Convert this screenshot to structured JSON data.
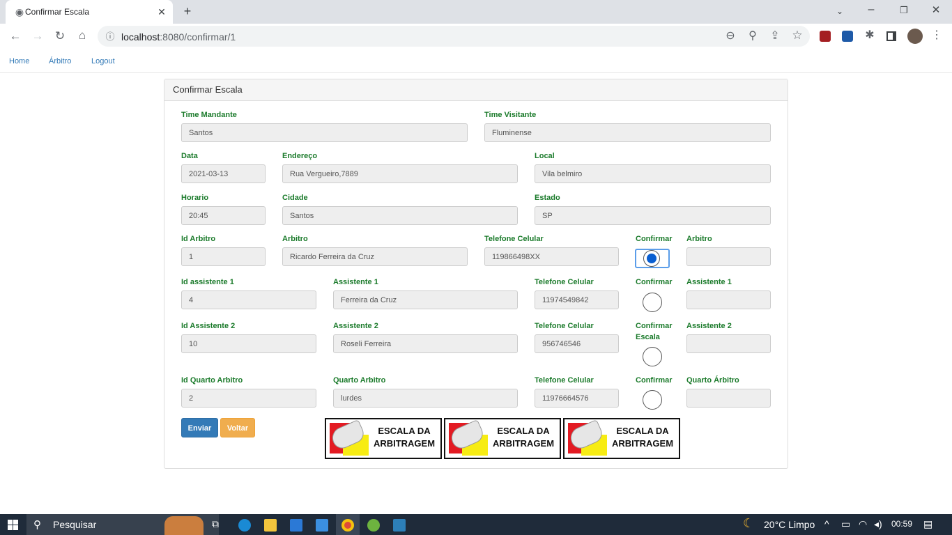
{
  "browser": {
    "tab_title": "Confirmar Escala",
    "url_host": "localhost",
    "url_rest": ":8080/confirmar/1"
  },
  "nav": {
    "home": "Home",
    "arbitro": "Árbitro",
    "logout": "Logout"
  },
  "panel": {
    "title": "Confirmar Escala"
  },
  "form": {
    "time_mandante": {
      "label": "Time Mandante",
      "value": "Santos"
    },
    "time_visitante": {
      "label": "Time Visitante",
      "value": "Fluminense"
    },
    "data": {
      "label": "Data",
      "value": "2021-03-13"
    },
    "endereco": {
      "label": "Endereço",
      "value": "Rua Vergueiro,7889"
    },
    "local": {
      "label": "Local",
      "value": "Vila belmiro"
    },
    "horario": {
      "label": "Horario",
      "value": "20:45"
    },
    "cidade": {
      "label": "Cidade",
      "value": "Santos"
    },
    "estado": {
      "label": "Estado",
      "value": "SP"
    },
    "rows": [
      {
        "id_label": "Id Arbitro",
        "id_value": "1",
        "name_label": "Arbitro",
        "name_value": "Ricardo Ferreira da Cruz",
        "phone_label": "Telefone Celular",
        "phone_value": "119866498XX",
        "confirm_label": "Confirmar",
        "confirmed": true,
        "extra_label": "Arbitro",
        "extra_value": ""
      },
      {
        "id_label": "Id assistente 1",
        "id_value": "4",
        "name_label": "Assistente 1",
        "name_value": " Ferreira da Cruz",
        "phone_label": "Telefone Celular",
        "phone_value": "11974549842",
        "confirm_label": "Confirmar",
        "confirmed": false,
        "extra_label": "Assistente 1",
        "extra_value": ""
      },
      {
        "id_label": "Id Assistente 2",
        "id_value": "10",
        "name_label": "Assistente 2",
        "name_value": "Roseli Ferreira",
        "phone_label": "Telefone Celular",
        "phone_value": "956746546",
        "confirm_label": "Confirmar",
        "confirm_label2": "Escala",
        "confirmed": false,
        "extra_label": "Assistente 2",
        "extra_value": ""
      },
      {
        "id_label": "Id Quarto Arbitro",
        "id_value": "2",
        "name_label": "Quarto Arbitro",
        "name_value": "lurdes",
        "phone_label": "Telefone Celular",
        "phone_value": "11976664576",
        "confirm_label": "Confirmar",
        "confirmed": false,
        "extra_label": "Quarto Árbitro",
        "extra_value": ""
      }
    ]
  },
  "buttons": {
    "enviar": "Enviar",
    "voltar": "Voltar"
  },
  "banner": {
    "line1": "ESCALA DA",
    "line2": "ARBITRAGEM"
  },
  "taskbar": {
    "search": "Pesquisar",
    "weather": "20°C  Limpo",
    "time": "00:59"
  },
  "colors": {
    "label_green": "#1a7a2a",
    "btn_primary": "#337ab7",
    "btn_warning": "#f0ad4e",
    "radio_selected": "#0a5fd1"
  }
}
